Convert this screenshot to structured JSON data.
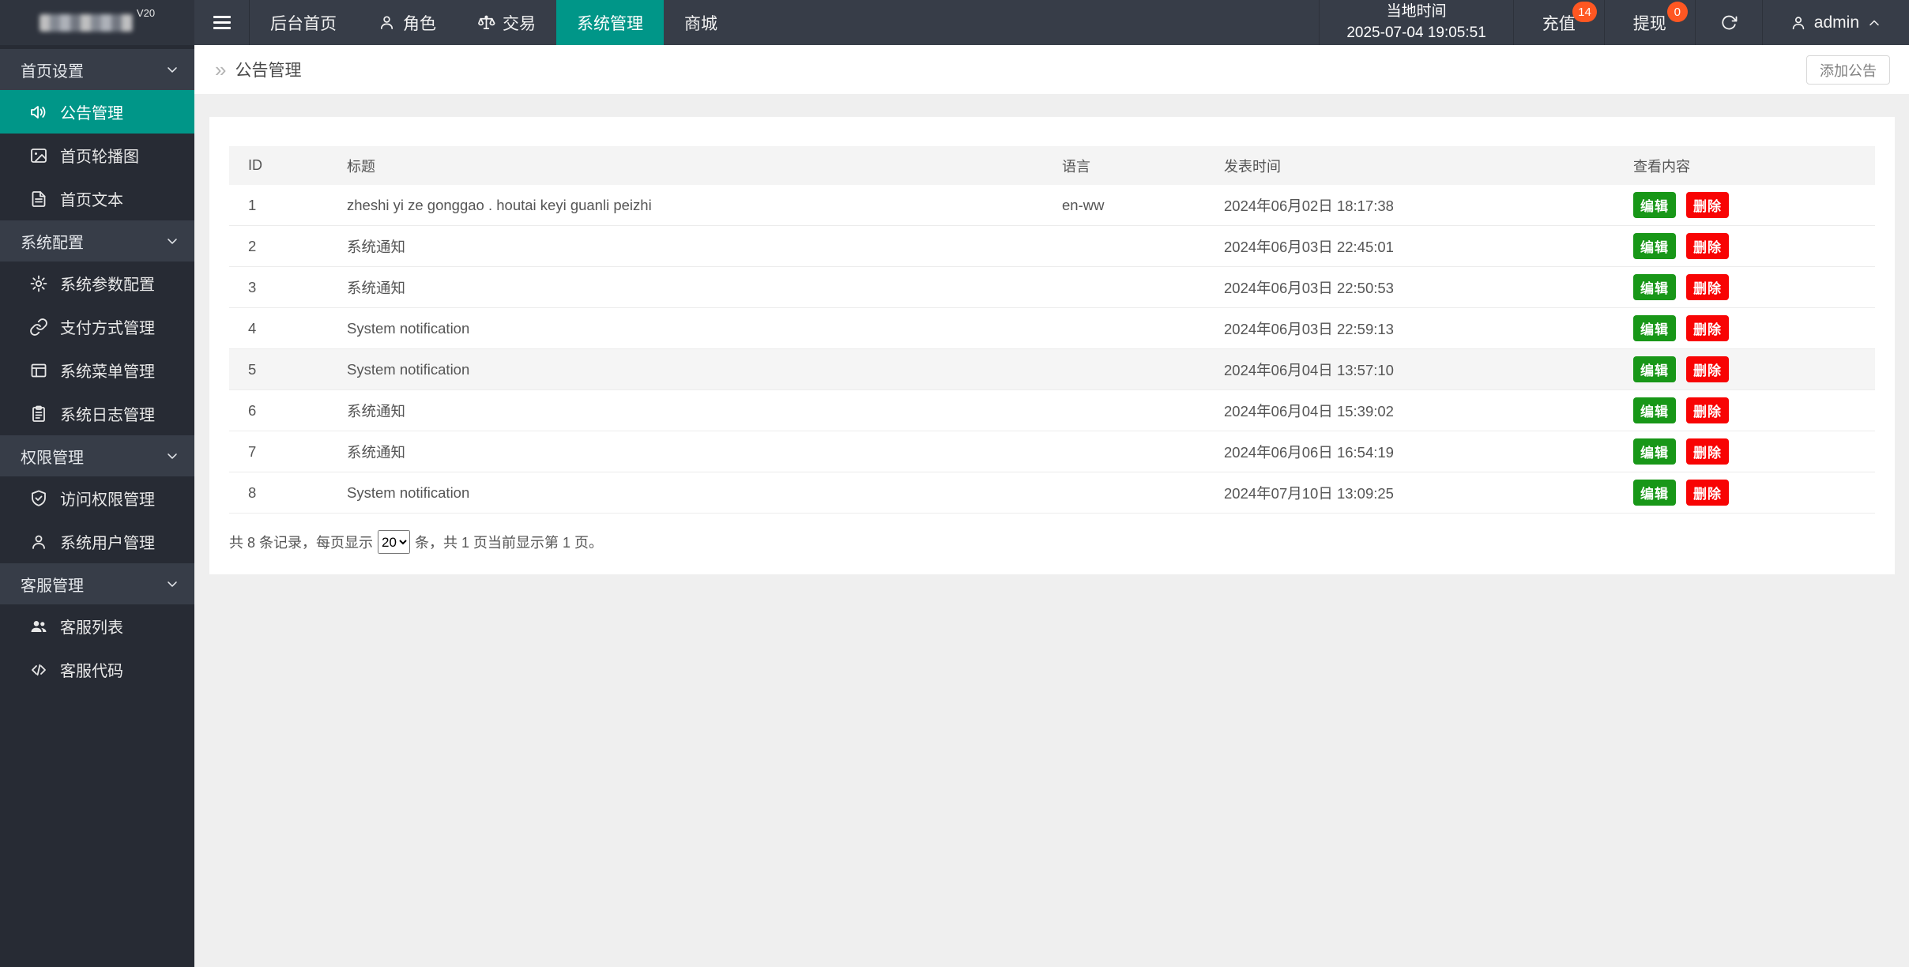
{
  "brand": {
    "version": "V20"
  },
  "navbar": {
    "items": [
      {
        "name": "home",
        "label": "后台首页",
        "icon": null,
        "active": false
      },
      {
        "name": "roles",
        "label": "角色",
        "icon": "user",
        "active": false
      },
      {
        "name": "trade",
        "label": "交易",
        "icon": "scales",
        "active": false
      },
      {
        "name": "system",
        "label": "系统管理",
        "icon": null,
        "active": true
      },
      {
        "name": "mall",
        "label": "商城",
        "icon": null,
        "active": false
      }
    ],
    "time": {
      "label": "当地时间",
      "value": "2025-07-04 19:05:51"
    },
    "recharge": {
      "label": "充值",
      "badge": "14"
    },
    "withdraw": {
      "label": "提现",
      "badge": "0"
    },
    "user": {
      "name": "admin"
    }
  },
  "sidebar": {
    "groups": [
      {
        "name": "home-settings",
        "label": "首页设置",
        "items": [
          {
            "name": "announcements",
            "label": "公告管理",
            "icon": "speaker",
            "active": true
          },
          {
            "name": "home-carousel",
            "label": "首页轮播图",
            "icon": "image",
            "active": false
          },
          {
            "name": "home-text",
            "label": "首页文本",
            "icon": "file-text",
            "active": false
          }
        ]
      },
      {
        "name": "system-config",
        "label": "系统配置",
        "items": [
          {
            "name": "system-params",
            "label": "系统参数配置",
            "icon": "gear",
            "active": false
          },
          {
            "name": "payment-methods",
            "label": "支付方式管理",
            "icon": "link",
            "active": false
          },
          {
            "name": "system-menus",
            "label": "系统菜单管理",
            "icon": "table",
            "active": false
          },
          {
            "name": "system-logs",
            "label": "系统日志管理",
            "icon": "clipboard",
            "active": false
          }
        ]
      },
      {
        "name": "permissions",
        "label": "权限管理",
        "items": [
          {
            "name": "access-perms",
            "label": "访问权限管理",
            "icon": "shield-check",
            "active": false
          },
          {
            "name": "system-users",
            "label": "系统用户管理",
            "icon": "user",
            "active": false
          }
        ]
      },
      {
        "name": "customer-service",
        "label": "客服管理",
        "items": [
          {
            "name": "cs-list",
            "label": "客服列表",
            "icon": "users",
            "active": false
          },
          {
            "name": "cs-code",
            "label": "客服代码",
            "icon": "code",
            "active": false
          }
        ]
      }
    ]
  },
  "page": {
    "breadcrumb": "公告管理",
    "add_button": "添加公告"
  },
  "icons": {
    "breadcrumb_double_chevron": "»"
  },
  "table": {
    "columns": [
      "ID",
      "标题",
      "语言",
      "发表时间",
      "查看内容"
    ],
    "edit_label": "编辑",
    "delete_label": "删除",
    "rows": [
      {
        "id": "1",
        "title": "zheshi yi ze gonggao . houtai keyi guanli peizhi",
        "lang": "en-ww",
        "time": "2024年06月02日 18:17:38",
        "highlight": false
      },
      {
        "id": "2",
        "title": "系统通知",
        "lang": "",
        "time": "2024年06月03日 22:45:01",
        "highlight": false
      },
      {
        "id": "3",
        "title": "系统通知",
        "lang": "",
        "time": "2024年06月03日 22:50:53",
        "highlight": false
      },
      {
        "id": "4",
        "title": "System notification",
        "lang": "",
        "time": "2024年06月03日 22:59:13",
        "highlight": false
      },
      {
        "id": "5",
        "title": "System notification",
        "lang": "",
        "time": "2024年06月04日 13:57:10",
        "highlight": true
      },
      {
        "id": "6",
        "title": "系统通知",
        "lang": "",
        "time": "2024年06月04日 15:39:02",
        "highlight": false
      },
      {
        "id": "7",
        "title": "系统通知",
        "lang": "",
        "time": "2024年06月06日 16:54:19",
        "highlight": false
      },
      {
        "id": "8",
        "title": "System notification",
        "lang": "",
        "time": "2024年07月10日 13:09:25",
        "highlight": false
      }
    ]
  },
  "pagination": {
    "prefix": "共 8 条记录，每页显示",
    "per_page": "20",
    "suffix": "条，共 1 页当前显示第 1 页。"
  },
  "colors": {
    "accent_teal": "#009688",
    "badge_orange": "#ff5722",
    "edit_green": "#189718",
    "delete_red": "#f80404",
    "navbar_bg": "#373d48",
    "sidebar_bg": "#272b34"
  }
}
